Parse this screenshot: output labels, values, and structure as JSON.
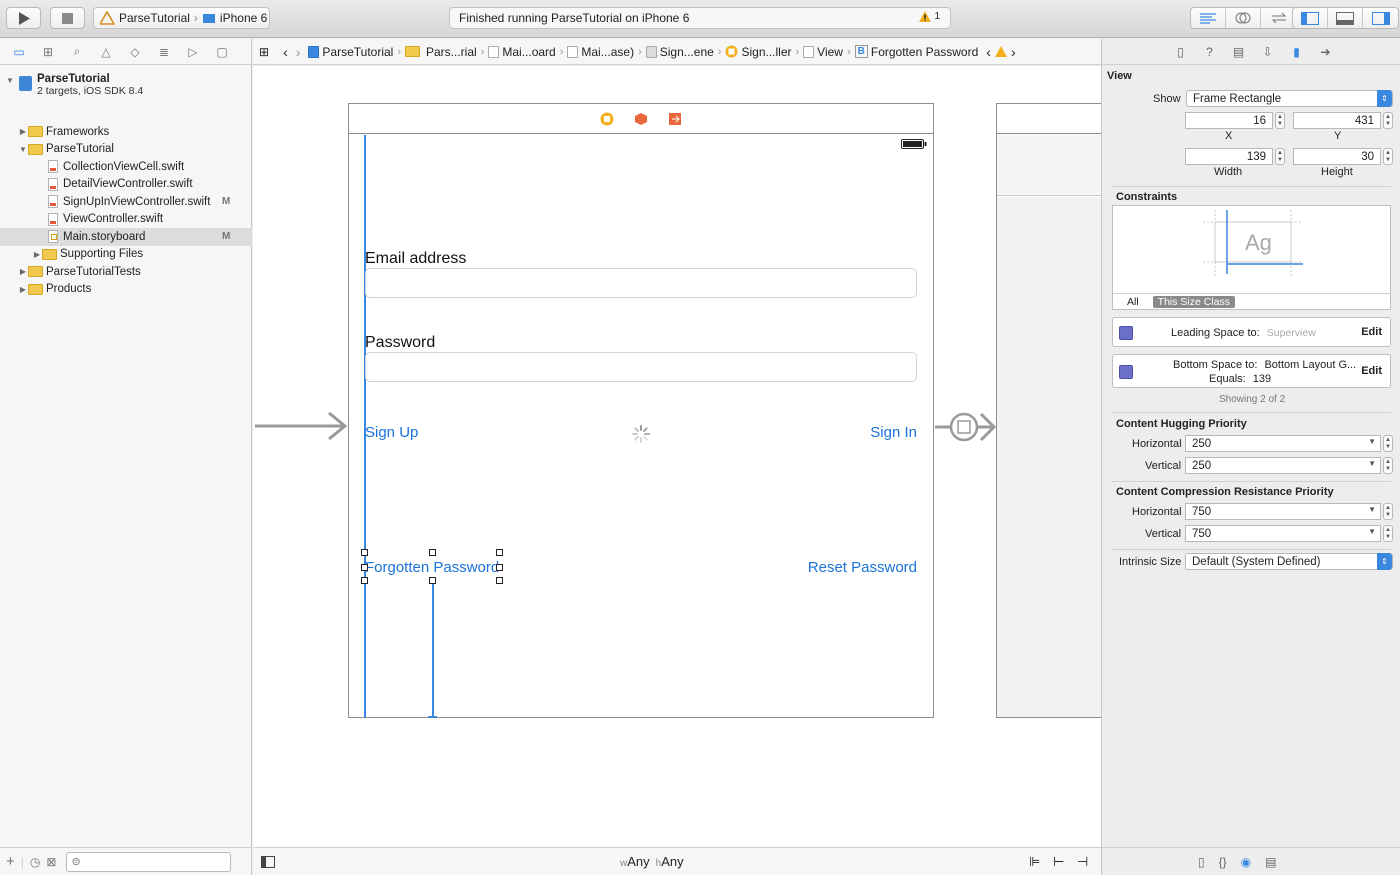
{
  "toolbar": {
    "scheme_name": "ParseTutorial",
    "device": "iPhone 6",
    "status_text": "Finished running ParseTutorial on iPhone 6",
    "warning_count": "1"
  },
  "navigator": {
    "project_name": "ParseTutorial",
    "project_subtitle": "2 targets, iOS SDK 8.4",
    "items": [
      {
        "label": "Frameworks",
        "type": "folder",
        "badge": ""
      },
      {
        "label": "ParseTutorial",
        "type": "folder",
        "badge": ""
      },
      {
        "label": "CollectionViewCell.swift",
        "type": "swift",
        "badge": ""
      },
      {
        "label": "DetailViewController.swift",
        "type": "swift",
        "badge": ""
      },
      {
        "label": "SignUpInViewController.swift",
        "type": "swift",
        "badge": "M"
      },
      {
        "label": "ViewController.swift",
        "type": "swift",
        "badge": ""
      },
      {
        "label": "Main.storyboard",
        "type": "storyboard",
        "badge": "M"
      },
      {
        "label": "Supporting Files",
        "type": "folder",
        "badge": ""
      },
      {
        "label": "ParseTutorialTests",
        "type": "folder",
        "badge": ""
      },
      {
        "label": "Products",
        "type": "folder",
        "badge": ""
      }
    ]
  },
  "jumpbar": {
    "crumbs": [
      "ParseTutorial",
      "Pars...rial",
      "Mai...oard",
      "Mai...ase)",
      "Sign...ene",
      "Sign...ller",
      "View",
      "Forgotten Password"
    ]
  },
  "scene": {
    "email_label": "Email address",
    "password_label": "Password",
    "sign_up": "Sign Up",
    "sign_in": "Sign In",
    "forgotten_password": "Forgotten Password",
    "reset_password": "Reset Password"
  },
  "canvas_bottom": {
    "w_prefix": "w",
    "w_value": "Any",
    "h_prefix": "h",
    "h_value": "Any"
  },
  "inspector": {
    "section_view": "View",
    "show_label": "Show",
    "show_value": "Frame Rectangle",
    "x_value": "16",
    "x_label": "X",
    "y_value": "431",
    "y_label": "Y",
    "width_value": "139",
    "width_label": "Width",
    "height_value": "30",
    "height_label": "Height",
    "constraints_title": "Constraints",
    "ag_text": "Ag",
    "tab_all": "All",
    "tab_size_class": "This Size Class",
    "c1_label": "Leading Space to:",
    "c1_value": "Superview",
    "c2_label": "Bottom Space to:",
    "c2_value": "Bottom Layout G...",
    "c2_equals_label": "Equals:",
    "c2_equals_value": "139",
    "edit_label": "Edit",
    "showing": "Showing 2 of 2",
    "hugging_title": "Content Hugging Priority",
    "horizontal_label": "Horizontal",
    "vertical_label": "Vertical",
    "hug_h": "250",
    "hug_v": "250",
    "compression_title": "Content Compression Resistance Priority",
    "comp_h": "750",
    "comp_v": "750",
    "intrinsic_label": "Intrinsic Size",
    "intrinsic_value": "Default (System Defined)"
  }
}
